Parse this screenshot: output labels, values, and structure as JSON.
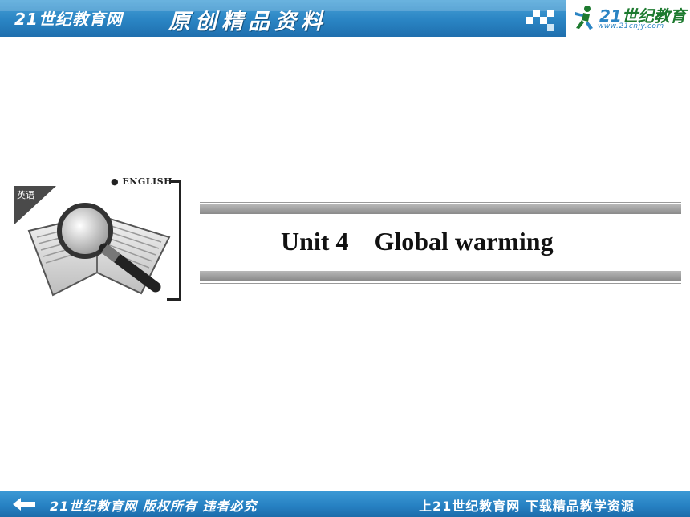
{
  "header": {
    "brand_left": "21世纪教育网",
    "title": "原创精品资料",
    "logo_text_num": "21",
    "logo_text": "世纪教育",
    "logo_url": "www.21cnjy.com"
  },
  "emblem": {
    "subject_badge": "英语",
    "english_label": "● ENGLISH"
  },
  "slide": {
    "title": "Unit 4    Global warming"
  },
  "footer": {
    "left_text": "21世纪教育网 版权所有 违者必究",
    "right_text": "上21世纪教育网 下载精品教学资源"
  },
  "colors": {
    "banner_blue": "#2a84c3",
    "title_bar_gray": "#9a9a9a",
    "logo_green": "#1d7a2f"
  }
}
